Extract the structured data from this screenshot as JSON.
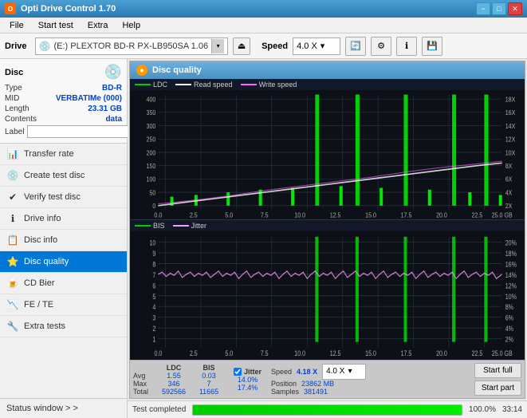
{
  "window": {
    "title": "Opti Drive Control 1.70",
    "min_btn": "−",
    "max_btn": "□",
    "close_btn": "✕"
  },
  "menu": {
    "items": [
      "File",
      "Start test",
      "Extra",
      "Help"
    ]
  },
  "toolbar": {
    "drive_label": "Drive",
    "drive_value": "(E:)  PLEXTOR BD-R  PX-LB950SA 1.06",
    "speed_label": "Speed",
    "speed_value": "4.0 X"
  },
  "sidebar": {
    "disc_title": "Disc",
    "disc_fields": [
      {
        "label": "Type",
        "value": "BD-R"
      },
      {
        "label": "MID",
        "value": "VERBATIMe (000)"
      },
      {
        "label": "Length",
        "value": "23.31 GB"
      },
      {
        "label": "Contents",
        "value": "data"
      }
    ],
    "label_placeholder": "",
    "nav_items": [
      {
        "id": "transfer-rate",
        "label": "Transfer rate",
        "icon": "📊"
      },
      {
        "id": "create-test-disc",
        "label": "Create test disc",
        "icon": "💿"
      },
      {
        "id": "verify-test-disc",
        "label": "Verify test disc",
        "icon": "✔"
      },
      {
        "id": "drive-info",
        "label": "Drive info",
        "icon": "ℹ"
      },
      {
        "id": "disc-info",
        "label": "Disc info",
        "icon": "📋"
      },
      {
        "id": "disc-quality",
        "label": "Disc quality",
        "icon": "⭐"
      },
      {
        "id": "cd-bier",
        "label": "CD Bier",
        "icon": "🍺"
      },
      {
        "id": "fe-te",
        "label": "FE / TE",
        "icon": "📉"
      },
      {
        "id": "extra-tests",
        "label": "Extra tests",
        "icon": "🔧"
      }
    ],
    "status_window_label": "Status window > >"
  },
  "disc_quality": {
    "title": "Disc quality",
    "legend": {
      "ldc": "LDC",
      "read_speed": "Read speed",
      "write_speed": "Write speed",
      "bis": "BIS",
      "jitter": "Jitter"
    },
    "chart1": {
      "y_left_labels": [
        "400",
        "350",
        "300",
        "250",
        "200",
        "150",
        "100",
        "50",
        "0"
      ],
      "y_right_labels": [
        "18X",
        "16X",
        "14X",
        "12X",
        "10X",
        "8X",
        "6X",
        "4X",
        "2X"
      ],
      "x_labels": [
        "0.0",
        "2.5",
        "5.0",
        "7.5",
        "10.0",
        "12.5",
        "15.0",
        "17.5",
        "20.0",
        "22.5",
        "25.0"
      ]
    },
    "chart2": {
      "y_left_labels": [
        "10",
        "9",
        "8",
        "7",
        "6",
        "5",
        "4",
        "3",
        "2",
        "1"
      ],
      "y_right_labels": [
        "20%",
        "18%",
        "16%",
        "14%",
        "12%",
        "10%",
        "8%",
        "6%",
        "4%",
        "2%"
      ],
      "x_labels": [
        "0.0",
        "2.5",
        "5.0",
        "7.5",
        "10.0",
        "12.5",
        "15.0",
        "17.5",
        "20.0",
        "22.5",
        "25.0"
      ]
    },
    "stats": {
      "columns": [
        "LDC",
        "BIS",
        "",
        "Jitter",
        "Speed"
      ],
      "avg": {
        "ldc": "1.55",
        "bis": "0.03",
        "jitter": "14.0%"
      },
      "max": {
        "ldc": "346",
        "bis": "7",
        "jitter": "17.4%"
      },
      "total": {
        "ldc": "592566",
        "bis": "11665"
      },
      "speed_value": "4.18 X",
      "speed_dropdown": "4.0 X",
      "position": "23862 MB",
      "samples": "381491"
    },
    "buttons": {
      "start_full": "Start full",
      "start_part": "Start part"
    }
  },
  "progress": {
    "percent": 100,
    "label": "Test completed",
    "time": "33:14"
  },
  "colors": {
    "ldc_color": "#00cc00",
    "read_speed_color": "#ffffff",
    "write_speed_color": "#ff66ff",
    "bis_color": "#00cc00",
    "jitter_color": "#ff99ff",
    "spike_color": "#00ff00",
    "accent_blue": "#0044cc",
    "active_nav": "#0078d7"
  }
}
